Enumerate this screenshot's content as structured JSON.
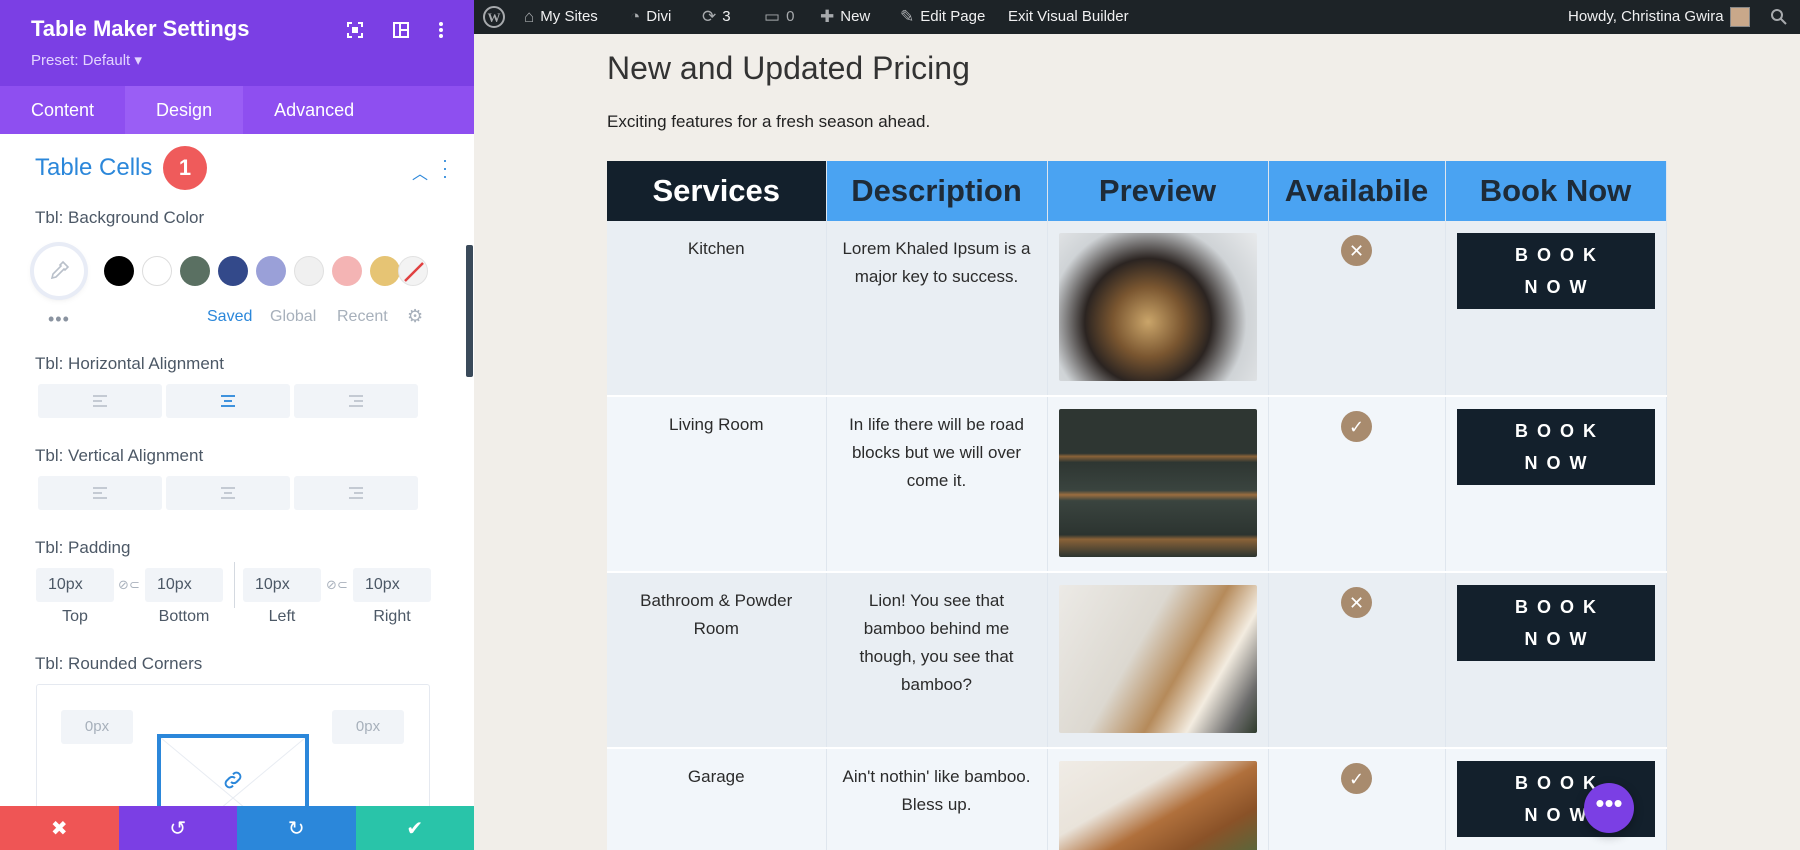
{
  "panel": {
    "title": "Table Maker Settings",
    "preset": "Preset: Default ▾",
    "tabs": [
      {
        "label": "Content",
        "active": false
      },
      {
        "label": "Design",
        "active": true
      },
      {
        "label": "Advanced",
        "active": false
      }
    ],
    "section": {
      "title": "Table Cells",
      "badge": "1"
    },
    "bg_color": {
      "label": "Tbl: Background Color",
      "swatches": [
        "#000000",
        "#ffffff",
        "#5a7062",
        "#33498a",
        "#9aa0d8",
        "#f0f0f0",
        "#f4b4b4",
        "#e6c474",
        "none"
      ],
      "tabs": [
        {
          "label": "Saved",
          "active": true
        },
        {
          "label": "Global",
          "active": false
        },
        {
          "label": "Recent",
          "active": false
        }
      ],
      "more": "•••"
    },
    "h_align": {
      "label": "Tbl: Horizontal Alignment",
      "selected": 1
    },
    "v_align": {
      "label": "Tbl: Vertical Alignment",
      "selected": -1
    },
    "padding": {
      "label": "Tbl: Padding",
      "fields": [
        {
          "value": "10px",
          "label": "Top"
        },
        {
          "value": "10px",
          "label": "Bottom"
        },
        {
          "value": "10px",
          "label": "Left"
        },
        {
          "value": "10px",
          "label": "Right"
        }
      ]
    },
    "corners": {
      "label": "Tbl: Rounded Corners",
      "top_left": "0px",
      "top_right": "0px"
    },
    "footer": {
      "cancel": "✖",
      "undo": "↺",
      "redo": "↻",
      "save": "✔"
    }
  },
  "adminbar": {
    "my_sites": "My Sites",
    "divi": "Divi",
    "updates": "3",
    "comments": "0",
    "new": "New",
    "edit_page": "Edit Page",
    "exit_vb": "Exit Visual Builder",
    "howdy": "Howdy, Christina Gwira"
  },
  "page": {
    "title": "New and Updated Pricing",
    "subtitle": "Exciting features for a fresh season ahead.",
    "table": {
      "headers": [
        "Services",
        "Description",
        "Preview",
        "Availabile",
        "Book Now"
      ],
      "rows": [
        {
          "service": "Kitchen",
          "description": "Lorem Khaled Ipsum is a major key to success.",
          "available": false,
          "book_line1": "BOOK",
          "book_line2": "NOW",
          "photo": "chandelier"
        },
        {
          "service": "Living Room",
          "description": "In life there will be road blocks but we will over come it.",
          "available": true,
          "book_line1": "BOOK",
          "book_line2": "NOW",
          "photo": "shelves"
        },
        {
          "service": "Bathroom & Powder Room",
          "description": "Lion! You see that bamboo behind me though, you see that bamboo?",
          "available": false,
          "book_line1": "BOOK",
          "book_line2": "NOW",
          "photo": "lounge"
        },
        {
          "service": "Garage",
          "description": "Ain't nothin' like bamboo. Bless up.",
          "available": true,
          "book_line1": "BOOK",
          "book_line2": "NOW",
          "photo": "sofa"
        }
      ]
    },
    "fab": "•••"
  }
}
